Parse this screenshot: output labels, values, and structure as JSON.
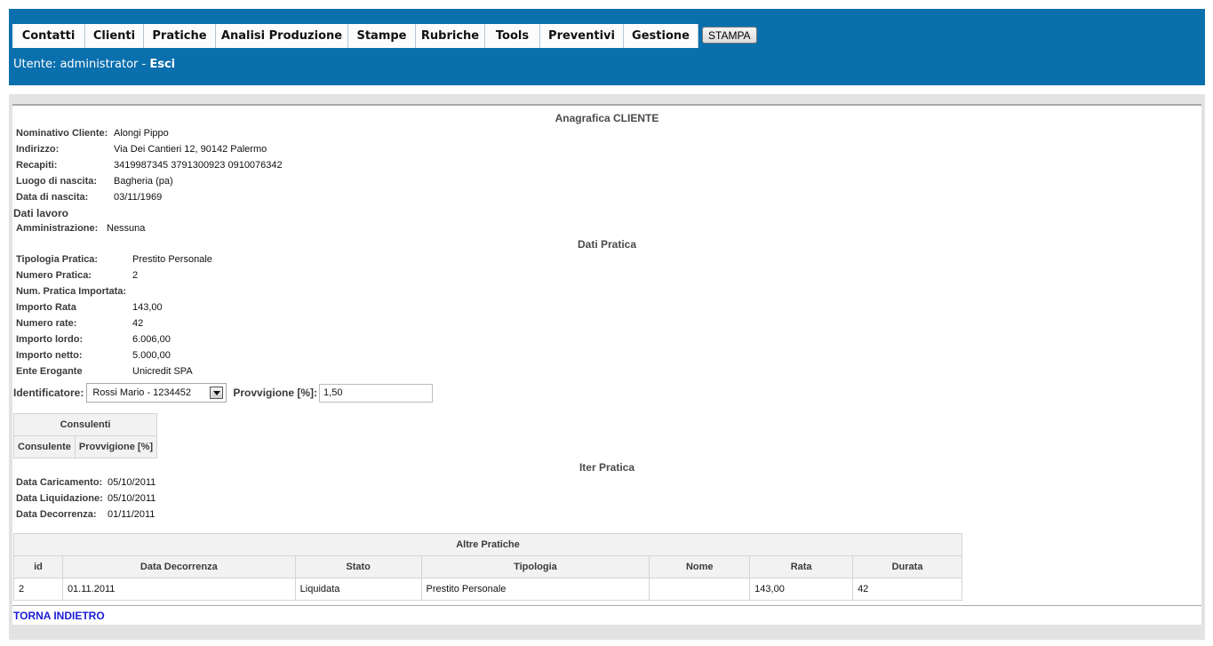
{
  "menu": {
    "items": [
      "Contatti",
      "Clienti",
      "Pratiche",
      "Analisi Produzione",
      "Stampe",
      "Rubriche",
      "Tools",
      "Preventivi",
      "Gestione"
    ],
    "print_button": "STAMPA"
  },
  "user": {
    "prefix": "Utente: administrator - ",
    "logout": "Esci"
  },
  "anagrafica": {
    "title": "Anagrafica CLIENTE",
    "fields": [
      {
        "label": "Nominativo Cliente:",
        "value": "Alongi Pippo"
      },
      {
        "label": "Indirizzo:",
        "value": "Via Dei Cantieri 12, 90142 Palermo"
      },
      {
        "label": "Recapiti:",
        "value": "3419987345 3791300923 0910076342"
      },
      {
        "label": "Luogo di nascita:",
        "value": "Bagheria (pa)"
      },
      {
        "label": "Data di nascita:",
        "value": "03/11/1969"
      }
    ],
    "work_heading": "Dati lavoro",
    "work_field": {
      "label": "Amministrazione:",
      "value": "Nessuna"
    }
  },
  "pratica": {
    "title": "Dati Pratica",
    "fields": [
      {
        "label": "Tipologia Pratica:",
        "value": "Prestito Personale"
      },
      {
        "label": "Numero Pratica:",
        "value": "2"
      },
      {
        "label": "Num. Pratica Importata:",
        "value": ""
      },
      {
        "label": "Importo Rata",
        "value": "143,00"
      },
      {
        "label": "Numero rate:",
        "value": "42"
      },
      {
        "label": "Importo lordo:",
        "value": "6.006,00"
      },
      {
        "label": "Importo netto:",
        "value": "5.000,00"
      },
      {
        "label": "Ente Erogante",
        "value": "Unicredit SPA"
      }
    ],
    "identificatore_label": "Identificatore:",
    "identificatore_value": "Rossi Mario - 1234452",
    "provvigione_label": "Provvigione [%]:",
    "provvigione_value": "1,50"
  },
  "consulenti": {
    "title": "Consulenti",
    "columns": [
      "Consulente",
      "Provvigione [%]"
    ]
  },
  "iter": {
    "title": "Iter Pratica",
    "fields": [
      {
        "label": "Data Caricamento:",
        "value": "05/10/2011"
      },
      {
        "label": "Data Liquidazione:",
        "value": "05/10/2011"
      },
      {
        "label": "Data Decorrenza:",
        "value": "01/11/2011"
      }
    ]
  },
  "altre_pratiche": {
    "title": "Altre Pratiche",
    "columns": [
      "id",
      "Data Decorrenza",
      "Stato",
      "Tipologia",
      "Nome",
      "Rata",
      "Durata"
    ],
    "rows": [
      [
        "2",
        "01.11.2011",
        "Liquidata",
        "Prestito Personale",
        "",
        "143,00",
        "42"
      ]
    ]
  },
  "back_link": "TORNA INDIETRO",
  "colors": {
    "header_bg": "#0a6fad",
    "frame_bg": "#e3e3e3",
    "link": "#1c1cd6"
  }
}
